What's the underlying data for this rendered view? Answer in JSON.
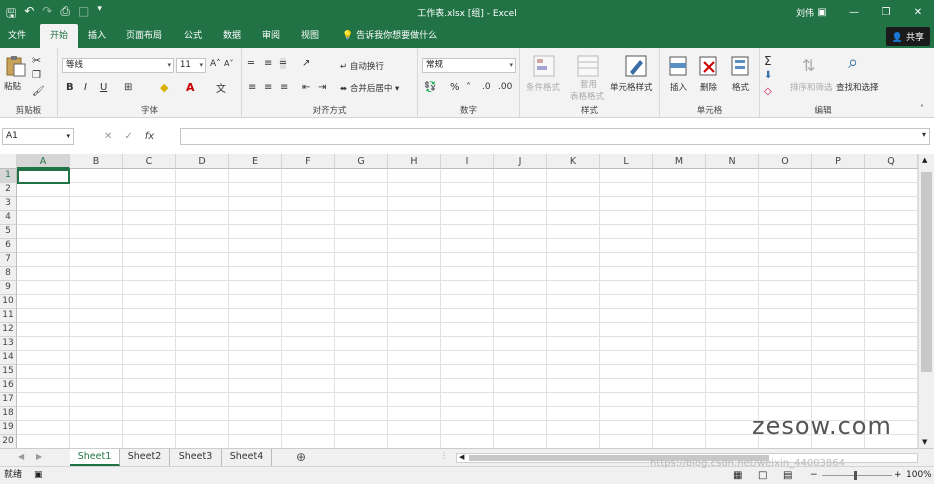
{
  "titlebar": {
    "title": "工作表.xlsx  [组]  -  Excel",
    "user": "刘伟"
  },
  "tabs": [
    {
      "label": "文件"
    },
    {
      "label": "开始"
    },
    {
      "label": "插入"
    },
    {
      "label": "页面布局"
    },
    {
      "label": "公式"
    },
    {
      "label": "数据"
    },
    {
      "label": "审阅"
    },
    {
      "label": "视图"
    }
  ],
  "tellme": "告诉我你想要做什么",
  "share": "共享",
  "ribbon": {
    "clipboard": {
      "paste": "粘贴",
      "label": "剪贴板"
    },
    "font": {
      "name": "等线",
      "size": "11",
      "label": "字体",
      "bold": "B",
      "italic": "I",
      "underline": "U"
    },
    "alignment": {
      "wrap": "自动换行",
      "merge": "合并后居中",
      "label": "对齐方式"
    },
    "number": {
      "format": "常规",
      "percent": "%",
      "label": "数字"
    },
    "styles": {
      "conditional": "条件格式",
      "table_line1": "套用",
      "table_line2": "表格格式",
      "cell_styles": "单元格样式",
      "label": "样式"
    },
    "cells": {
      "insert": "插入",
      "delete": "删除",
      "format": "格式",
      "label": "单元格"
    },
    "editing": {
      "sort": "排序和筛选",
      "find": "查找和选择",
      "label": "编辑"
    }
  },
  "formula": {
    "namebox": "A1",
    "fx": "fx",
    "value": ""
  },
  "columns": [
    "A",
    "B",
    "C",
    "D",
    "E",
    "F",
    "G",
    "H",
    "I",
    "J",
    "K",
    "L",
    "M",
    "N",
    "O",
    "P",
    "Q"
  ],
  "rows": [
    "1",
    "2",
    "3",
    "4",
    "5",
    "6",
    "7",
    "8",
    "9",
    "10",
    "11",
    "12",
    "13",
    "14",
    "15",
    "16",
    "17",
    "18",
    "19",
    "20"
  ],
  "sheets": [
    "Sheet1",
    "Sheet2",
    "Sheet3",
    "Sheet4"
  ],
  "status": {
    "ready": "就绪",
    "zoom": "100%"
  },
  "watermark": {
    "brand": "zesow.com",
    "url": "https://blog.csdn.net/weixin_44003864"
  },
  "colors": {
    "accent": "#217346"
  }
}
